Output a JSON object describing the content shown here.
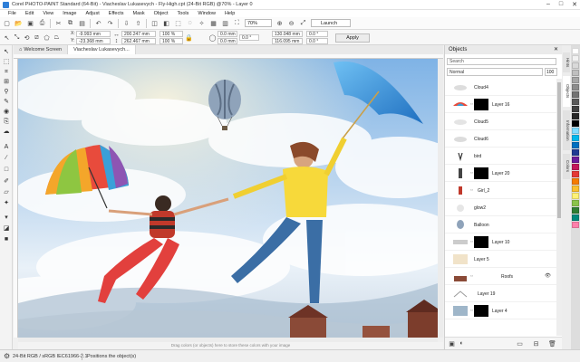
{
  "window": {
    "title": "Corel PHOTO-PAINT Standard (64-Bit) - Viacheslav Lukasevych - Fly-High.cpt (24-Bit RGB) @70% - Layer 0",
    "minimize_icon": "minimize-icon",
    "maximize_icon": "maximize-icon",
    "close_icon": "close-icon"
  },
  "menu": [
    "File",
    "Edit",
    "View",
    "Image",
    "Adjust",
    "Effects",
    "Mask",
    "Object",
    "Tools",
    "Window",
    "Help"
  ],
  "toolbar": {
    "zoom": "70%",
    "launch": "Launch"
  },
  "propbar": {
    "x_label": "X:",
    "x_value": "-9.993 mm",
    "y_label": "Y:",
    "y_value": "-23.368 mm",
    "w_value": "200.247 mm",
    "h_value": "262.467 mm",
    "scale_x": "100 %",
    "scale_y": "100 %",
    "pos_a": "0.0 mm",
    "pos_b": "0.0 mm",
    "angle": "0.0 °",
    "size_a": "130.048 mm",
    "size_b": "116.095 mm",
    "skew_a": "0.0 °",
    "skew_b": "0.0 °",
    "apply_label": "Apply"
  },
  "tabs": [
    {
      "label": "Welcome Screen"
    },
    {
      "label": "Viacheslav Lukasevych..."
    }
  ],
  "canvas": {
    "hint": "Drag colors (or objects) here to store these colors with your image"
  },
  "objects_panel": {
    "title": "Objects",
    "search_placeholder": "Search",
    "blend_mode": "Normal",
    "opacity": "100",
    "layers": [
      {
        "name": "Cloud4"
      },
      {
        "name": "Layer 16"
      },
      {
        "name": "Cloud5"
      },
      {
        "name": "Cloud6"
      },
      {
        "name": "bird"
      },
      {
        "name": "Layer 20"
      },
      {
        "name": "Girl_2"
      },
      {
        "name": "glow2"
      },
      {
        "name": "Balloon"
      },
      {
        "name": "Layer 10"
      },
      {
        "name": "Layer 5"
      },
      {
        "name": "Roofs"
      },
      {
        "name": "Layer 19"
      },
      {
        "name": "Layer 4"
      }
    ]
  },
  "side_tabs": [
    "Hints",
    "Objects",
    "Information",
    "Colors"
  ],
  "palette": [
    "#ffffff",
    "#f2f2f2",
    "#d9d9d9",
    "#bfbfbf",
    "#a6a6a6",
    "#8c8c8c",
    "#737373",
    "#595959",
    "#404040",
    "#262626",
    "#000000",
    "#7fdbff",
    "#00b7eb",
    "#0070c0",
    "#1f3a93",
    "#6a1b9a",
    "#c2185b",
    "#e53935",
    "#f57c00",
    "#fbc02d",
    "#fff176",
    "#8bc34a",
    "#2e7d32",
    "#00897b",
    "#ff80ab"
  ],
  "status": {
    "color_info": "24-Bit RGB / sRGB IEC61966-2.1",
    "message": "Positions the object(s)"
  }
}
